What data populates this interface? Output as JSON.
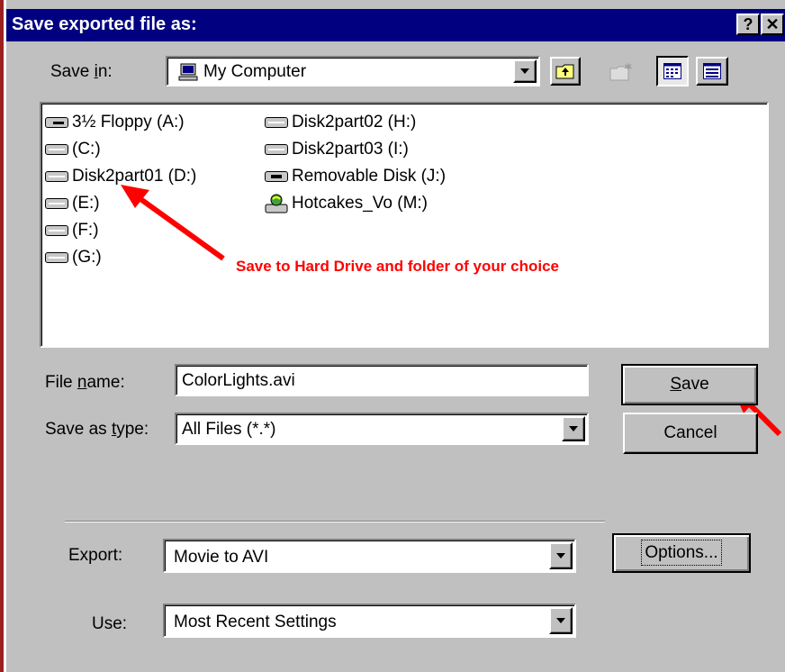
{
  "window": {
    "title": "Save exported file as:",
    "help_label": "?",
    "close_label": "✕"
  },
  "save_in": {
    "label_pre": "Save ",
    "label_key": "i",
    "label_post": "n:",
    "value": "My Computer"
  },
  "files": {
    "col1": [
      "3½ Floppy (A:)",
      "(C:)",
      "Disk2part01 (D:)",
      "(E:)",
      "(F:)",
      "(G:)"
    ],
    "col2": [
      "Disk2part02 (H:)",
      "Disk2part03 (I:)",
      "Removable Disk (J:)",
      "Hotcakes_Vo (M:)"
    ]
  },
  "annotation": {
    "text": "Save to Hard Drive and folder of your choice",
    "color": "#ff0000"
  },
  "file_name": {
    "label_pre": "File ",
    "label_key": "n",
    "label_post": "ame:",
    "value": "ColorLights.avi"
  },
  "save_type": {
    "label_pre": "Save as ",
    "label_key": "t",
    "label_post": "ype:",
    "value": "All Files (*.*)"
  },
  "buttons": {
    "save_key": "S",
    "save_rest": "ave",
    "cancel": "Cancel",
    "options": "Options..."
  },
  "export": {
    "label": "Export:",
    "value": "Movie to AVI"
  },
  "use": {
    "label": "Use:",
    "value": "Most Recent Settings"
  }
}
